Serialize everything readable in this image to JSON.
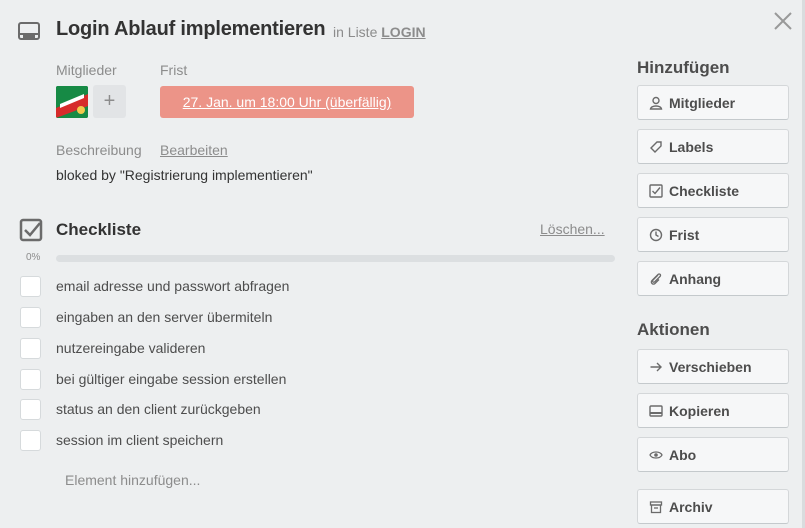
{
  "card": {
    "title": "Login Ablauf implementieren",
    "in_list_prefix": "in Liste",
    "list_name": "LOGIN"
  },
  "members": {
    "label": "Mitglieder",
    "add_symbol": "+"
  },
  "due": {
    "label": "Frist",
    "value": "27. Jan. um 18:00 Uhr (überfällig)",
    "color": "#ec9488"
  },
  "description": {
    "label": "Beschreibung",
    "edit": "Bearbeiten",
    "text": "bloked by \"Registrierung implementieren\""
  },
  "checklist": {
    "title": "Checkliste",
    "delete": "Löschen...",
    "percent_label": "0%",
    "progress": 0,
    "items": [
      "email adresse und passwort abfragen",
      "eingaben an den server übermiteln",
      "nutzereingabe valideren",
      "bei gültiger eingabe session erstellen",
      "status an den client zurückgeben",
      "session im client speichern"
    ],
    "add_item": "Element hinzufügen..."
  },
  "sidebar": {
    "add_heading": "Hinzufügen",
    "add_buttons": [
      {
        "label": "Mitglieder",
        "icon": "person-icon"
      },
      {
        "label": "Labels",
        "icon": "label-icon"
      },
      {
        "label": "Checkliste",
        "icon": "checklist-icon"
      },
      {
        "label": "Frist",
        "icon": "clock-icon"
      },
      {
        "label": "Anhang",
        "icon": "paperclip-icon"
      }
    ],
    "actions_heading": "Aktionen",
    "action_buttons": [
      {
        "label": "Verschieben",
        "icon": "arrow-right-icon"
      },
      {
        "label": "Kopieren",
        "icon": "card-icon"
      },
      {
        "label": "Abo",
        "icon": "eye-icon"
      },
      {
        "label": "Archiv",
        "icon": "archive-icon"
      }
    ]
  }
}
